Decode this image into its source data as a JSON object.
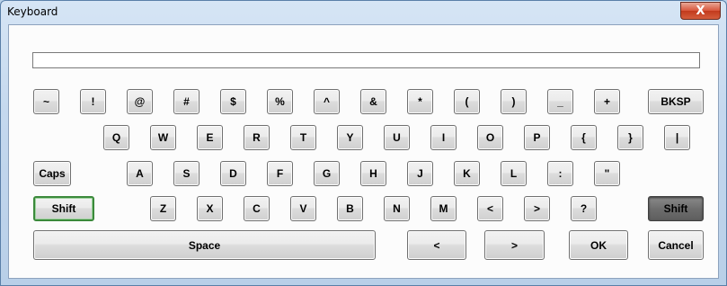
{
  "window": {
    "title": "Keyboard",
    "close_label": "X"
  },
  "input": {
    "value": ""
  },
  "rows": [
    [
      "~",
      "!",
      "@",
      "#",
      "$",
      "%",
      "^",
      "&",
      "*",
      "(",
      ")",
      "_",
      "+",
      "BKSP"
    ],
    [
      "Q",
      "W",
      "E",
      "R",
      "T",
      "Y",
      "U",
      "I",
      "O",
      "P",
      "{",
      "}",
      "|"
    ],
    [
      "Caps",
      "A",
      "S",
      "D",
      "F",
      "G",
      "H",
      "J",
      "K",
      "L",
      ":",
      "\""
    ],
    [
      "Shift",
      "Z",
      "X",
      "C",
      "V",
      "B",
      "N",
      "M",
      "<",
      ">",
      "?",
      "Shift"
    ],
    [
      "Space",
      "<",
      ">",
      "OK",
      "Cancel"
    ]
  ]
}
